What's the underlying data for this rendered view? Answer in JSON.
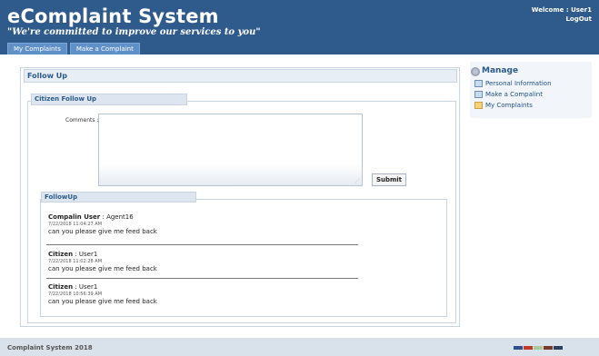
{
  "header": {
    "title": "eComplaint System",
    "tagline": "\"We're committed to improve our services to you\"",
    "welcome": "Welcome : User1",
    "logout": "LogOut",
    "tabs": [
      "My Complaints",
      "Make a Complaint"
    ]
  },
  "main": {
    "panel_title": "Follow Up",
    "section_title": "Citizen Follow Up",
    "comments_label": "Comments :",
    "comments_value": "",
    "submit_label": "Submit",
    "followup_title": "FollowUp",
    "followups": [
      {
        "role": "Compalin User",
        "sep": " : ",
        "user": "Agent16",
        "date": "7/22/2018 11:04:27 AM",
        "message": "can you please give me feed back"
      },
      {
        "role": "Citizen",
        "sep": " : ",
        "user": "User1",
        "date": "7/22/2018 11:02:28 AM",
        "message": "can you please give me feed back"
      },
      {
        "role": "Citizen",
        "sep": " : ",
        "user": "User1",
        "date": "7/22/2018 10:56:39 AM",
        "message": "can you please give me feed back"
      }
    ]
  },
  "sidebar": {
    "title": "Manage",
    "items": [
      {
        "label": "Personal Information",
        "icon": "page-icon"
      },
      {
        "label": "Make a Compalint",
        "icon": "page-icon"
      },
      {
        "label": "My Complaints",
        "icon": "folder-icon"
      }
    ]
  },
  "footer": {
    "text": "Complaint System 2018",
    "swatch_colors": [
      "#2f4f8f",
      "#c0392b",
      "#a8c8a0",
      "#7a3a2a",
      "#2f3f5f"
    ]
  }
}
